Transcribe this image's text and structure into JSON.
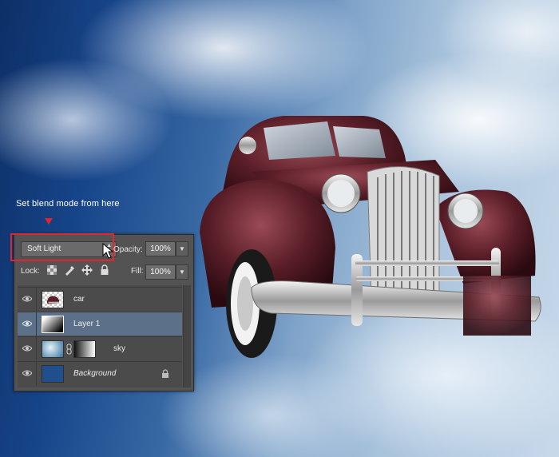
{
  "caption": "Set blend mode from here",
  "colors": {
    "highlight": "#e3262b",
    "selected_layer": "#5d7089",
    "panel": "#535353",
    "background_swatch": "#1f4f8c"
  },
  "panel": {
    "blend_mode": "Soft Light",
    "opacity_label": "Opacity:",
    "opacity_value": "100%",
    "lock_label": "Lock:",
    "lock_icons": [
      "lock-transparent-pixels-icon",
      "lock-image-pixels-icon",
      "lock-position-icon",
      "lock-all-icon"
    ],
    "fill_label": "Fill:",
    "fill_value": "100%"
  },
  "layers": [
    {
      "name": "car",
      "thumb": "car-thumbnail",
      "visible": true,
      "selected": false
    },
    {
      "name": "Layer 1",
      "thumb": "gradient-thumbnail",
      "visible": true,
      "selected": true
    },
    {
      "name": "sky",
      "thumb": "sky-thumbnail",
      "mask": "gradient-mask",
      "linked": true,
      "visible": true,
      "selected": false
    },
    {
      "name": "Background",
      "thumb": "blue-fill-thumbnail",
      "locked": true,
      "visible": true,
      "selected": false
    }
  ]
}
